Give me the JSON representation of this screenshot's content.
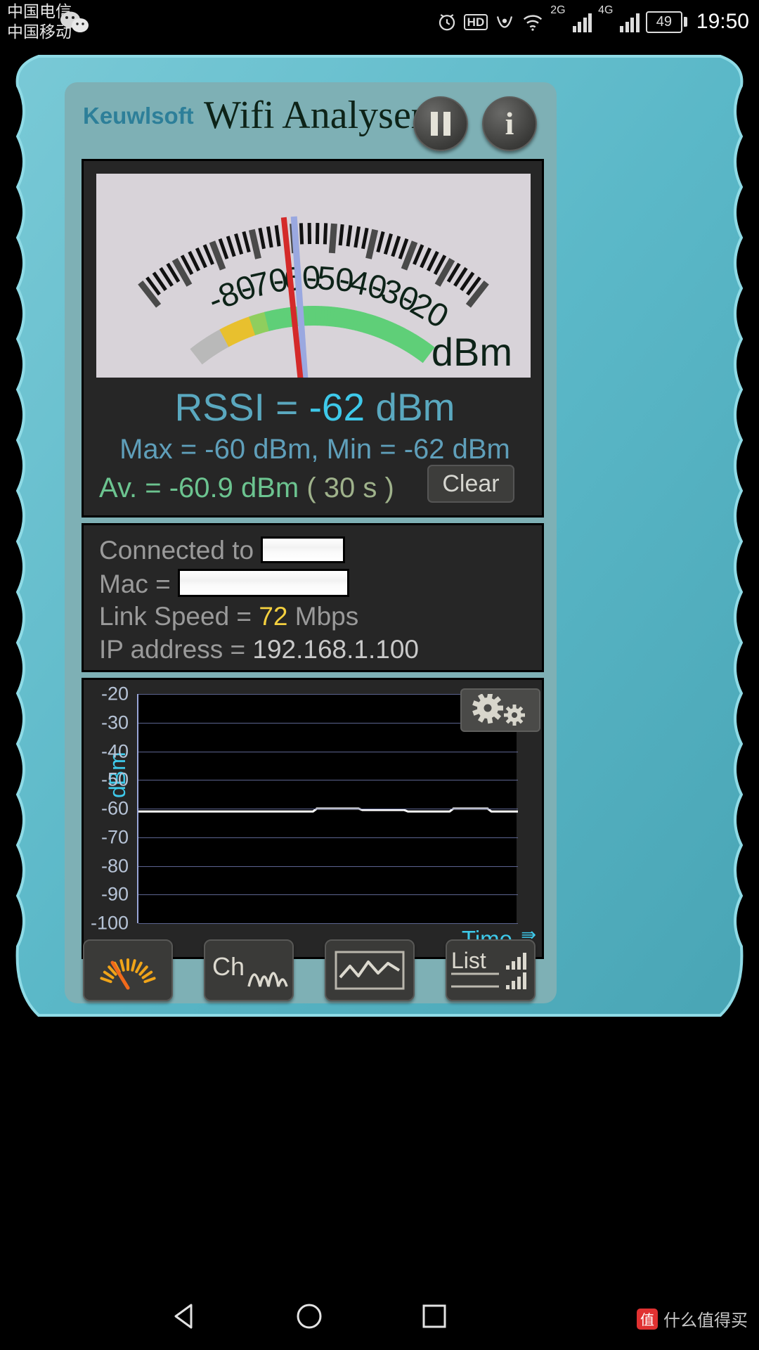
{
  "status_bar": {
    "carrier_1": "中国电信",
    "carrier_2": "中国移动",
    "clock": "19:50",
    "battery_percent": "49",
    "hd_label": "HD",
    "net_2g": "2G",
    "net_4g": "4G",
    "icons": [
      "wechat-icon",
      "alarm-icon",
      "hd-icon",
      "eye-icon",
      "wifi-icon",
      "signal-2g-icon",
      "signal-4g-icon",
      "battery-icon"
    ]
  },
  "header": {
    "brand": "Keuwlsoft",
    "title": "Wifi Analyser",
    "pause_label": "pause-icon",
    "info_label": "i"
  },
  "gauge": {
    "unit": "dBm",
    "tick_labels": [
      "-80",
      "-70",
      "-60",
      "-50",
      "-40",
      "-30",
      "-20"
    ],
    "needle_value": -62,
    "avg_needle_value": -60.9,
    "needle_color": "#d42a2a",
    "avg_needle_color": "#9aa8e0",
    "scale_min": -100,
    "scale_max": -10
  },
  "readout": {
    "rssi_prefix": "RSSI = ",
    "rssi_value": "-62",
    "rssi_suffix": " dBm",
    "minmax": "Max = -60 dBm,  Min = -62 dBm",
    "average_text": "Av. = -60.9 dBm  ",
    "average_window": "( 30 s )",
    "clear_label": "Clear"
  },
  "connection": {
    "ssid_label": "Connected to",
    "ssid_value": "",
    "mac_label": "Mac =",
    "mac_value": "",
    "speed_label": "Link Speed = ",
    "speed_value": "72",
    "speed_unit": " Mbps",
    "ip_label": "IP address = ",
    "ip_value": "192.168.1.100"
  },
  "chart_data": {
    "type": "line",
    "title": "",
    "xlabel": "Time",
    "ylabel": "dBm",
    "ylim": [
      -100,
      -20
    ],
    "yticks": [
      -20,
      -30,
      -40,
      -50,
      -60,
      -70,
      -80,
      -90,
      -100
    ],
    "ytick_labels": [
      "-20",
      "-30",
      "-40",
      "-50",
      "-60",
      "-70",
      "-80",
      "-90",
      "-100"
    ],
    "grid": true,
    "legend": "none",
    "series": [
      {
        "name": "RSSI",
        "color": "#ffffff",
        "x": [
          0,
          10,
          20,
          30,
          38,
          46,
          47,
          58,
          59,
          70,
          71,
          82,
          83,
          92,
          93,
          100
        ],
        "values": [
          -61,
          -61,
          -61,
          -61,
          -61,
          -61,
          -60,
          -60,
          -60.5,
          -60.5,
          -61,
          -61,
          -60,
          -60,
          -61,
          -61
        ]
      }
    ],
    "time_arrow": "⇛"
  },
  "toolbar": {
    "buttons": [
      {
        "name": "meter-view",
        "label": "",
        "icon": "gauge-icon",
        "active": true
      },
      {
        "name": "channel-view",
        "label": "Ch",
        "icon": "channel-hills-icon",
        "active": false
      },
      {
        "name": "graph-view",
        "label": "",
        "icon": "line-graph-icon",
        "active": false
      },
      {
        "name": "list-view",
        "label": "List",
        "icon": "signal-bars-icon",
        "active": false
      }
    ],
    "settings_label": "gears-icon"
  },
  "navbar": {
    "back": "back-triangle-icon",
    "home": "home-circle-icon",
    "recents": "recents-square-icon",
    "watermark_mark": "值",
    "watermark_text": "什么值得买"
  }
}
